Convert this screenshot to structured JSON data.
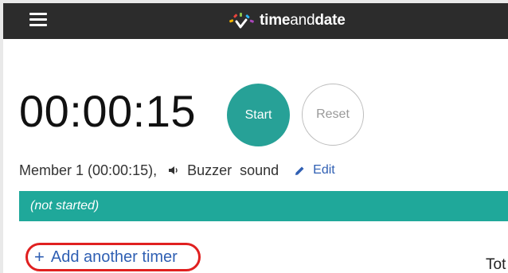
{
  "header": {
    "logo_text_bold_1": "time",
    "logo_text_light": "and",
    "logo_text_bold_2": "date",
    "menu_icon": "hamburger-icon"
  },
  "timer": {
    "display": "00:00:15",
    "start_label": "Start",
    "reset_label": "Reset",
    "member_text": "Member 1 (00:00:15),",
    "sound_icon": "speaker-icon",
    "sound_label": "Buzzer  sound",
    "edit_icon": "pencil-icon",
    "edit_label": "Edit",
    "status": "(not started)",
    "accent_color": "#27a197",
    "status_color": "#1fa89a"
  },
  "actions": {
    "add_timer_icon": "+",
    "add_timer_label": "Add another timer",
    "highlight_color": "#e02020"
  },
  "footer": {
    "total_label": "Tot"
  }
}
